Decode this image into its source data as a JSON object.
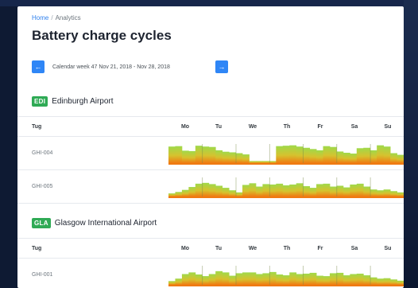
{
  "breadcrumb": {
    "home": "Home",
    "separator": "/",
    "current": "Analytics"
  },
  "page": {
    "title": "Battery charge cycles"
  },
  "week": {
    "label": "Calendar week 47   Nov 21, 2018 - Nov 28, 2018",
    "prev_icon": "arrow-left-icon",
    "next_icon": "arrow-right-icon"
  },
  "table": {
    "tug_header": "Tug",
    "days": [
      "Mo",
      "Tu",
      "We",
      "Th",
      "Fr",
      "Sa",
      "Su"
    ]
  },
  "colors": {
    "accent": "#2f86f6",
    "badge": "#2faa55",
    "charge_high": "#9fd94a",
    "charge_low": "#f07a12"
  },
  "airports": [
    {
      "code": "EDI",
      "name": "Edinburgh Airport",
      "tugs": [
        {
          "id": "GHI-004",
          "levels": [
            0.8,
            0.82,
            0.6,
            0.58,
            0.84,
            0.8,
            0.78,
            0.62,
            0.55,
            0.52,
            0.48,
            0.42,
            0.1,
            0.1,
            0.1,
            0.1,
            0.82,
            0.84,
            0.86,
            0.8,
            0.74,
            0.68,
            0.62,
            0.82,
            0.78,
            0.56,
            0.5,
            0.46,
            0.72,
            0.74,
            0.62,
            0.86,
            0.8,
            0.48,
            0.4
          ]
        },
        {
          "id": "GHI-005",
          "levels": [
            0.15,
            0.22,
            0.32,
            0.46,
            0.62,
            0.66,
            0.6,
            0.52,
            0.42,
            0.3,
            0.2,
            0.56,
            0.64,
            0.48,
            0.6,
            0.58,
            0.62,
            0.54,
            0.58,
            0.64,
            0.5,
            0.42,
            0.6,
            0.62,
            0.48,
            0.52,
            0.44,
            0.58,
            0.62,
            0.48,
            0.34,
            0.3,
            0.34,
            0.26,
            0.2
          ]
        }
      ]
    },
    {
      "code": "GLA",
      "name": "Glasgow International Airport",
      "tugs": [
        {
          "id": "GHI-001",
          "levels": [
            0.18,
            0.3,
            0.52,
            0.6,
            0.5,
            0.42,
            0.52,
            0.66,
            0.6,
            0.44,
            0.56,
            0.6,
            0.6,
            0.52,
            0.56,
            0.62,
            0.5,
            0.46,
            0.6,
            0.52,
            0.54,
            0.58,
            0.44,
            0.42,
            0.56,
            0.58,
            0.46,
            0.52,
            0.54,
            0.46,
            0.36,
            0.3,
            0.32,
            0.26,
            0.2
          ]
        }
      ]
    }
  ]
}
